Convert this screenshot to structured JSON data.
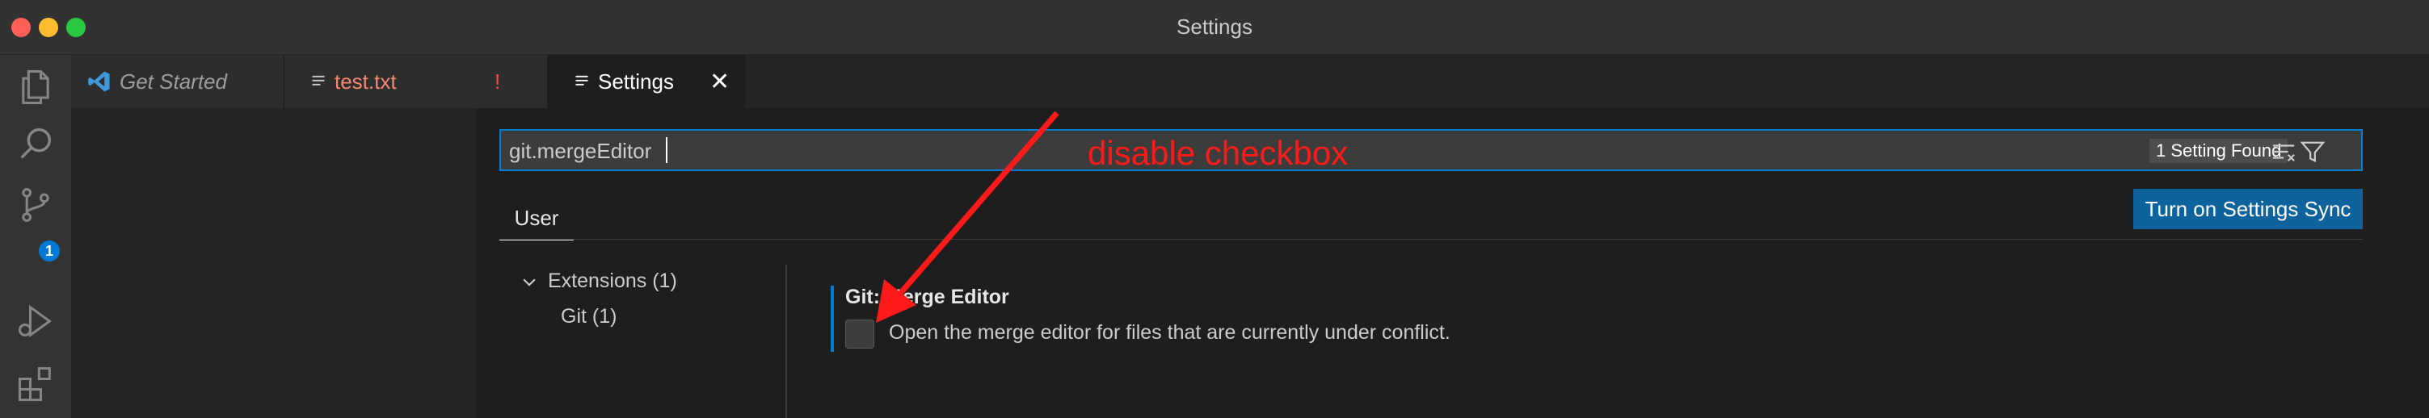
{
  "window": {
    "title": "Settings"
  },
  "activity_bar": {
    "items": [
      "explorer-icon",
      "search-icon",
      "source-control-icon",
      "run-debug-icon",
      "extensions-icon"
    ],
    "source_control_badge": "1"
  },
  "tabs": [
    {
      "label": "Get Started",
      "icon": "vscode-logo-icon"
    },
    {
      "label": "test.txt",
      "icon": "file-lines-icon",
      "status": "!"
    },
    {
      "label": "Settings",
      "icon": "settings-lines-icon",
      "close": "✕",
      "active": true
    }
  ],
  "settings": {
    "search_value": "git.mergeEditor",
    "results_count": "1 Setting Found",
    "scope_tab": "User",
    "sync_button": "Turn on Settings Sync",
    "toc": {
      "extensions": "Extensions (1)",
      "git": "Git (1)"
    },
    "item": {
      "title": "Git: Merge Editor",
      "description": "Open the merge editor for files that are currently under conflict.",
      "checked": false
    }
  },
  "annotation": {
    "text": "disable checkbox",
    "color": "#ff1a1a"
  },
  "colors": {
    "accent": "#007fd4",
    "button": "#0e639c",
    "badge": "#0078d4"
  }
}
